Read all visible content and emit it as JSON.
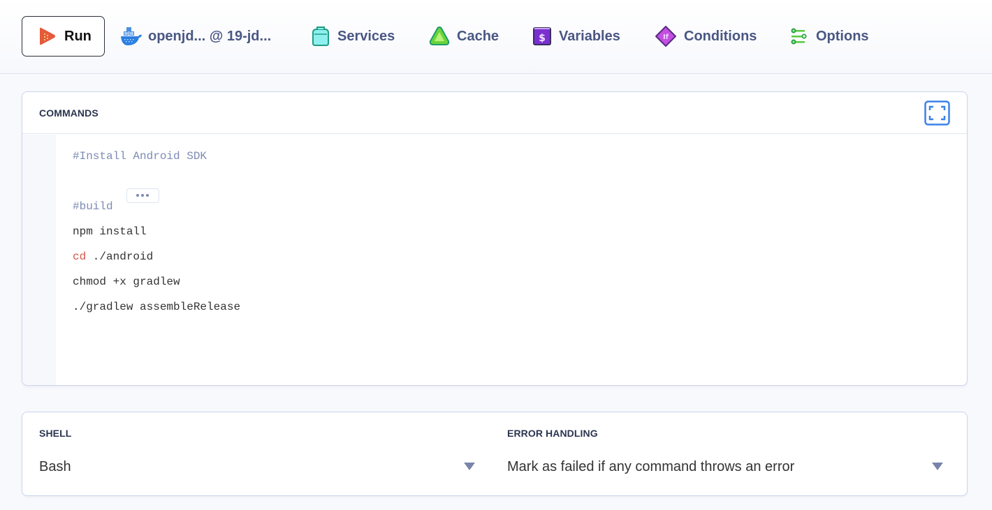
{
  "toolbar": {
    "run": {
      "label": "Run",
      "icon": "play-icon",
      "color": "#e55a3c"
    },
    "tabs": [
      {
        "label": "openjd... @ 19-jd...",
        "icon": "docker-whale-icon"
      },
      {
        "label": "Services",
        "icon": "services-box-icon"
      },
      {
        "label": "Cache",
        "icon": "cache-triangle-icon"
      },
      {
        "label": "Variables",
        "icon": "variables-dollar-icon"
      },
      {
        "label": "Conditions",
        "icon": "conditions-if-icon"
      },
      {
        "label": "Options",
        "icon": "options-sliders-icon"
      }
    ]
  },
  "commands": {
    "title": "COMMANDS",
    "expand_icon": "fullscreen-icon",
    "lines": [
      {
        "type": "comment",
        "text": "#Install Android SDK"
      },
      {
        "type": "fold",
        "text": "..."
      },
      {
        "type": "comment",
        "text": "#build"
      },
      {
        "type": "plain",
        "text": "npm install"
      },
      {
        "type": "keyword",
        "keyword": "cd",
        "text": " ./android"
      },
      {
        "type": "plain",
        "text": "chmod +x gradlew"
      },
      {
        "type": "plain",
        "text": "./gradlew assembleRelease"
      }
    ]
  },
  "settings": {
    "shell": {
      "label": "SHELL",
      "value": "Bash"
    },
    "error_handling": {
      "label": "ERROR HANDLING",
      "value": "Mark as failed if any command throws an error"
    }
  },
  "colors": {
    "accent": "#3b82e6",
    "tab_text": "#4a5783",
    "comment": "#7d8bb4",
    "keyword": "#d2574a"
  }
}
